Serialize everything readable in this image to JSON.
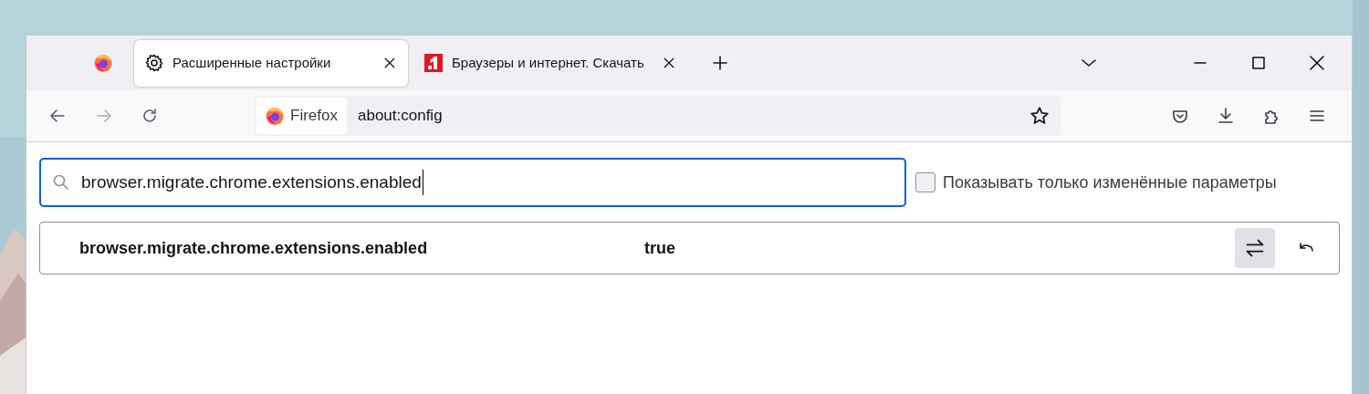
{
  "tabs": [
    {
      "kind": "pinned",
      "selected": false
    },
    {
      "kind": "settings",
      "label": "Расширенные настройки",
      "selected": true
    },
    {
      "kind": "site",
      "label": "Браузеры и интернет. Скачать",
      "selected": false
    }
  ],
  "toolbar": {
    "back_disabled": false,
    "forward_disabled": true,
    "identity_label": "Firefox",
    "url": "about:config"
  },
  "search": {
    "value": "browser.migrate.chrome.extensions.enabled"
  },
  "modified_only": {
    "label": "Показывать только изменённые параметры",
    "checked": false
  },
  "prefs": [
    {
      "name": "browser.migrate.chrome.extensions.enabled",
      "value": "true"
    }
  ]
}
